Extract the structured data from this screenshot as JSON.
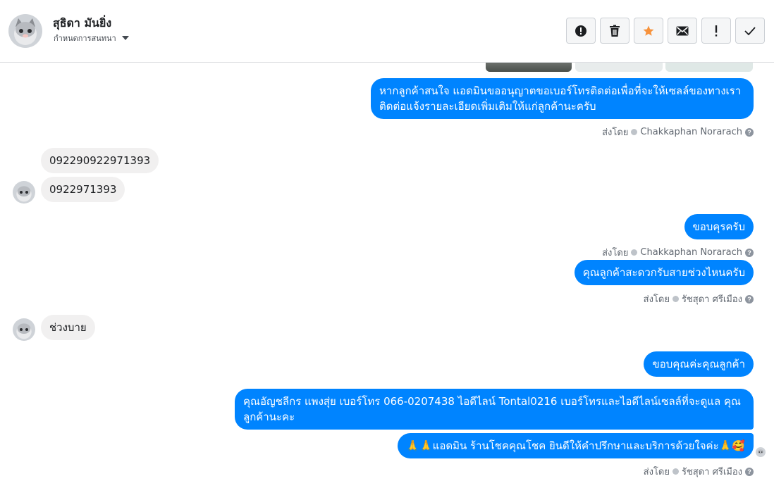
{
  "header": {
    "contact_name": "สุธิดา มันยิ่ง",
    "assign_label": "กำหนดการสนทนา",
    "actions": [
      {
        "name": "report-spam-button",
        "icon": "alert-circle-icon"
      },
      {
        "name": "delete-button",
        "icon": "trash-icon"
      },
      {
        "name": "star-button",
        "icon": "star-icon"
      },
      {
        "name": "mark-unread-button",
        "icon": "envelope-icon"
      },
      {
        "name": "follow-up-button",
        "icon": "exclamation-icon"
      },
      {
        "name": "mark-done-button",
        "icon": "checkmark-icon"
      }
    ]
  },
  "colors": {
    "accent": "#0084ff",
    "star": "#f7923b",
    "incoming_bg": "#f1f0f0"
  },
  "messages": {
    "m1": "หากลูกค้าสนใจ แอดมินขออนุญาตขอเบอร์โทรติดต่อเพื่อที่จะให้เซลล์ของทางเรา ติดต่อแจ้งรายละเอียดเพิ่มเติมให้แก่ลูกค้านะครับ",
    "m2": "092290922971393",
    "m3": "0922971393",
    "m4": "ขอบคุรครับ",
    "m5": "คุณลูกค้าสะดวกรับสายช่วงไหนครับ",
    "m6": "ช่วงบาย",
    "m7": "ขอบคุณค่ะคุณลูกค้า",
    "m8": "คุณอัญชลีกร แพงสุ่ย      เบอร์โทร 066-0207438 ไอดีไลน์ Tontal0216   เบอร์โทรและไอดีไลน์เซลล์ที่จะดูแล คุณลูกค้านะคะ",
    "m9": "🙏🙏แอดมิน ร้านโชคคุณโชค ยินดีให้คำปรึกษาและบริการด้วยใจค่ะ🙏🥰"
  },
  "sent_by": {
    "prefix": "ส่งโดย",
    "agent1": "Chakkaphan Norarach",
    "agent2": "รัชสุดา ศรีเมือง",
    "help": "?"
  }
}
